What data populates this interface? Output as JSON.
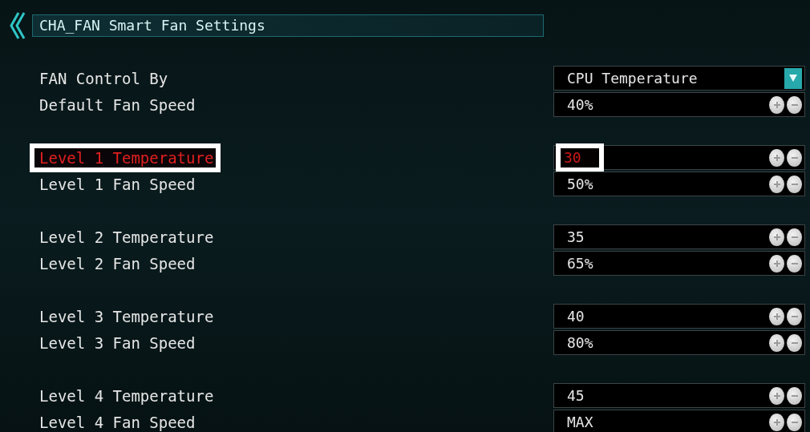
{
  "header": {
    "title": "CHA_FAN Smart Fan Settings"
  },
  "groups": [
    {
      "rows": [
        {
          "label": "FAN Control By",
          "value": "CPU Temperature",
          "kind": "dropdown",
          "selected": false
        },
        {
          "label": "Default Fan Speed",
          "value": "40%",
          "kind": "stepper",
          "selected": false
        }
      ]
    },
    {
      "rows": [
        {
          "label": "Level 1 Temperature",
          "value": "30",
          "kind": "stepper",
          "selected": true
        },
        {
          "label": "Level 1 Fan Speed",
          "value": "50%",
          "kind": "stepper",
          "selected": false
        }
      ]
    },
    {
      "rows": [
        {
          "label": "Level 2 Temperature",
          "value": "35",
          "kind": "stepper",
          "selected": false
        },
        {
          "label": "Level 2 Fan Speed",
          "value": "65%",
          "kind": "stepper",
          "selected": false
        }
      ]
    },
    {
      "rows": [
        {
          "label": "Level 3 Temperature",
          "value": "40",
          "kind": "stepper",
          "selected": false
        },
        {
          "label": "Level 3 Fan Speed",
          "value": "80%",
          "kind": "stepper",
          "selected": false
        }
      ]
    },
    {
      "rows": [
        {
          "label": "Level 4 Temperature",
          "value": "45",
          "kind": "stepper",
          "selected": false
        },
        {
          "label": "Level 4 Fan Speed",
          "value": "MAX",
          "kind": "stepper",
          "selected": false
        }
      ]
    }
  ]
}
